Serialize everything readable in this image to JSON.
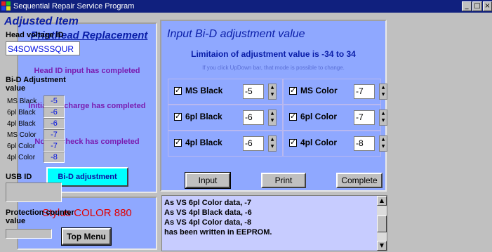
{
  "window": {
    "title": "Sequential Repair Service Program"
  },
  "left_panel": {
    "title": "Printhead Replacement",
    "statuses": [
      "Head ID input has completed",
      "Initial ink charge has completed",
      "Nozzle check has completed"
    ],
    "bid_button": "Bi-D adjustment"
  },
  "model_panel": {
    "model_name": "Stylus COLOR 880",
    "top_menu_button": "Top Menu"
  },
  "center_panel": {
    "title": "Input Bi-D adjustment value",
    "limit_text": "Limitaion of adjustment value is -34 to 34",
    "hint_text": "If you click UpDown bar, that mode is possible to change.",
    "adjustments": [
      {
        "label": "MS Black",
        "value": "-5"
      },
      {
        "label": "MS Color",
        "value": "-7"
      },
      {
        "label": "6pl Black",
        "value": "-6"
      },
      {
        "label": "6pl Color",
        "value": "-7"
      },
      {
        "label": "4pl Black",
        "value": "-6"
      },
      {
        "label": "4pl Color",
        "value": "-8"
      }
    ],
    "buttons": {
      "input": "Input",
      "print": "Print",
      "complete": "Complete"
    }
  },
  "log": {
    "lines": [
      "As VS 6pl Color data, -7",
      "As VS 4pl Black data, -6",
      "As VS 4pl Color data, -8",
      " has been written in EEPROM."
    ]
  },
  "right_panel": {
    "title": "Adjusted Item",
    "head_voltage_label": "Head voltage ID",
    "head_voltage_value": "S4SOWSSSQUR",
    "bid_label": "Bi-D Adjustment value",
    "bid_rows": [
      {
        "label": "MS Black",
        "value": "-5"
      },
      {
        "label": "6pl Black",
        "value": "-6"
      },
      {
        "label": "4pl Black",
        "value": "-6"
      },
      {
        "label": "MS Color",
        "value": "-7"
      },
      {
        "label": "6pl Color",
        "value": "-7"
      },
      {
        "label": "4pl Color",
        "value": "-8"
      }
    ],
    "usb_label": "USB ID",
    "protection_label": "Protection counter value"
  },
  "colors": {
    "panel_blue": "#8fa8ff",
    "title_blue": "#0a1ea8",
    "status_purple": "#7a1cb0",
    "model_red": "#e00000"
  }
}
